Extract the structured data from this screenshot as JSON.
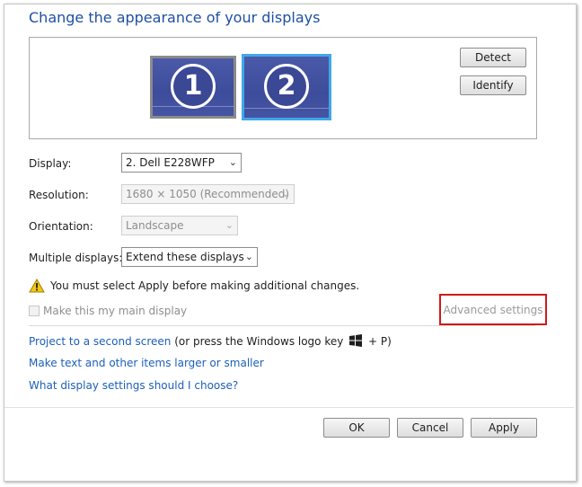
{
  "page": {
    "title": "Change the appearance of your displays"
  },
  "monitors": [
    {
      "number": "1",
      "selected": false
    },
    {
      "number": "2",
      "selected": true
    }
  ],
  "buttons": {
    "detect": "Detect",
    "identify": "Identify",
    "ok": "OK",
    "cancel": "Cancel",
    "apply": "Apply"
  },
  "settings": {
    "display_label": "Display:",
    "display_value": "2. Dell E228WFP",
    "resolution_label": "Resolution:",
    "resolution_value": "1680 × 1050 (Recommended)",
    "orientation_label": "Orientation:",
    "orientation_value": "Landscape",
    "multiple_label": "Multiple displays:",
    "multiple_value": "Extend these displays"
  },
  "warning": {
    "text": "You must select Apply before making additional changes.",
    "icon": "warning-icon"
  },
  "main_display": {
    "label": "Make this my main display",
    "checked": false,
    "enabled": false
  },
  "advanced": {
    "label": "Advanced settings"
  },
  "links": {
    "project_link": "Project to a second screen",
    "project_suffix_before": "(or press the Windows logo key",
    "project_suffix_after": "+ P)",
    "text_size": "Make text and other items larger or smaller",
    "help": "What display settings should I choose?"
  },
  "colors": {
    "title": "#1e4fa3",
    "link": "#1c5fb9",
    "highlight_box": "#d01919",
    "monitor_fill": "#3d4c9b",
    "selected_border": "#41a7e8"
  }
}
